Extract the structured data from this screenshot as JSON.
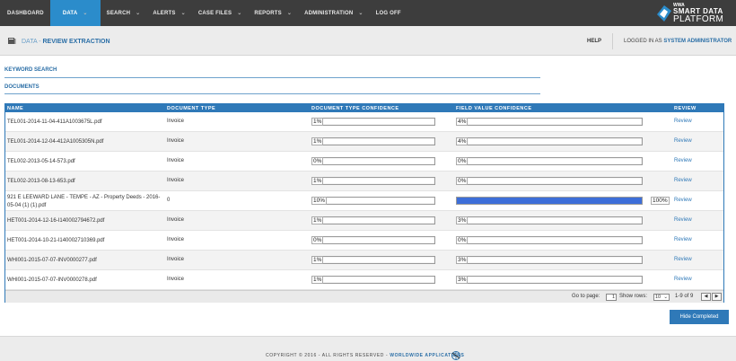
{
  "nav": {
    "items": [
      {
        "label": "DASHBOARD",
        "active": false,
        "caret": false
      },
      {
        "label": "DATA",
        "active": true,
        "caret": true
      },
      {
        "label": "SEARCH",
        "active": false,
        "caret": true
      },
      {
        "label": "ALERTS",
        "active": false,
        "caret": true
      },
      {
        "label": "CASE FILES",
        "active": false,
        "caret": true
      },
      {
        "label": "REPORTS",
        "active": false,
        "caret": true
      },
      {
        "label": "ADMINISTRATION",
        "active": false,
        "caret": true
      },
      {
        "label": "LOG OFF",
        "active": false,
        "caret": false
      }
    ],
    "caret_glyph": "⌄",
    "logo": {
      "small": "WWA",
      "line1": "SMART DATA",
      "line2": "PLATFORM"
    }
  },
  "breadcrumb": {
    "parent": "DATA",
    "separator": " - ",
    "current": "REVIEW EXTRACTION"
  },
  "header": {
    "help": "HELP",
    "logged_prefix": "LOGGED IN AS",
    "user": "SYSTEM ADMINISTRATOR"
  },
  "sections": {
    "keyword": "KEYWORD SEARCH",
    "documents": "DOCUMENTS"
  },
  "grid": {
    "columns": {
      "name": "NAME",
      "type": "DOCUMENT TYPE",
      "dtc": "DOCUMENT TYPE CONFIDENCE",
      "fvc": "FIELD VALUE CONFIDENCE",
      "review": "REVIEW"
    },
    "rows": [
      {
        "name": "TEL001-2014-11-04-411A1003675L.pdf",
        "type": "Invoice",
        "dtc": 1,
        "dtc_label": "1%",
        "fvc": 4,
        "fvc_label": "4%",
        "review": "Review"
      },
      {
        "name": "TEL001-2014-12-04-412A1005305N.pdf",
        "type": "Invoice",
        "dtc": 1,
        "dtc_label": "1%",
        "fvc": 4,
        "fvc_label": "4%",
        "review": "Review"
      },
      {
        "name": "TEL002-2013-05-14-573.pdf",
        "type": "Invoice",
        "dtc": 0,
        "dtc_label": "0%",
        "fvc": 0,
        "fvc_label": "0%",
        "review": "Review"
      },
      {
        "name": "TEL002-2013-08-13-653.pdf",
        "type": "Invoice",
        "dtc": 1,
        "dtc_label": "1%",
        "fvc": 0,
        "fvc_label": "0%",
        "review": "Review"
      },
      {
        "name": "921 E LEEWARD LANE - TEMPE - AZ - Property Deeds - 2016-05-04 (1) (1).pdf",
        "type": "0",
        "dtc": 10,
        "dtc_label": "10%",
        "fvc": 100,
        "fvc_label": "100%",
        "review": "Review"
      },
      {
        "name": "HET001-2014-12-16-I140002794672.pdf",
        "type": "Invoice",
        "dtc": 1,
        "dtc_label": "1%",
        "fvc": 3,
        "fvc_label": "3%",
        "review": "Review"
      },
      {
        "name": "HET001-2014-10-21-I140002710369.pdf",
        "type": "Invoice",
        "dtc": 0,
        "dtc_label": "0%",
        "fvc": 0,
        "fvc_label": "0%",
        "review": "Review"
      },
      {
        "name": "WHI001-2015-07-07-INV0000277.pdf",
        "type": "Invoice",
        "dtc": 1,
        "dtc_label": "1%",
        "fvc": 3,
        "fvc_label": "3%",
        "review": "Review"
      },
      {
        "name": "WHI001-2015-07-07-INV0000278.pdf",
        "type": "Invoice",
        "dtc": 1,
        "dtc_label": "1%",
        "fvc": 3,
        "fvc_label": "3%",
        "review": "Review"
      }
    ],
    "footer": {
      "goto_label": "Go to page:",
      "page_value": "1",
      "show_rows_label": "Show rows:",
      "rows_value": "10",
      "rows_caret": "⌄",
      "range": "1-9 of 9",
      "prev": "◀",
      "next": "▶"
    }
  },
  "hide_button": "Hide Completed",
  "footer": {
    "copyright": "COPYRIGHT © 2016 - ALL RIGHTS RESERVED -",
    "company": "WORLDWIDE APPLICATIONS"
  },
  "colors": {
    "accent": "#2f79b8",
    "bar_fill": "#3d6ed8",
    "nav_bg": "#3d3d3d"
  }
}
